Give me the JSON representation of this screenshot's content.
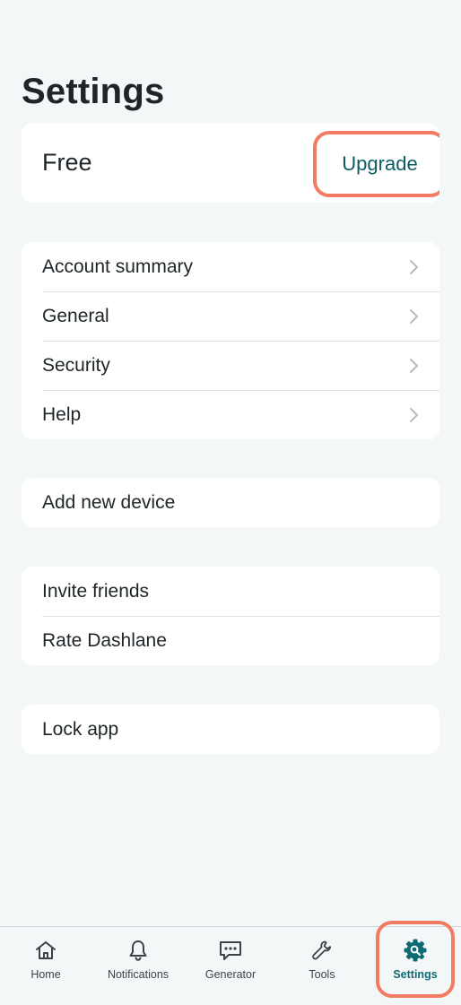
{
  "page": {
    "title": "Settings"
  },
  "plan": {
    "name": "Free",
    "upgrade_label": "Upgrade"
  },
  "menu": {
    "items": [
      {
        "label": "Account summary"
      },
      {
        "label": "General"
      },
      {
        "label": "Security"
      },
      {
        "label": "Help"
      }
    ]
  },
  "device": {
    "add_label": "Add new device"
  },
  "social": {
    "invite_label": "Invite friends",
    "rate_label": "Rate Dashlane"
  },
  "lock": {
    "label": "Lock app"
  },
  "tabbar": {
    "tabs": [
      {
        "label": "Home",
        "icon": "home-icon"
      },
      {
        "label": "Notifications",
        "icon": "bell-icon"
      },
      {
        "label": "Generator",
        "icon": "chat-icon"
      },
      {
        "label": "Tools",
        "icon": "wrench-icon"
      },
      {
        "label": "Settings",
        "icon": "gear-icon",
        "active": true
      }
    ]
  },
  "colors": {
    "accent": "#0d6b74",
    "highlight": "#f27b62",
    "background": "#f4f7f8"
  }
}
